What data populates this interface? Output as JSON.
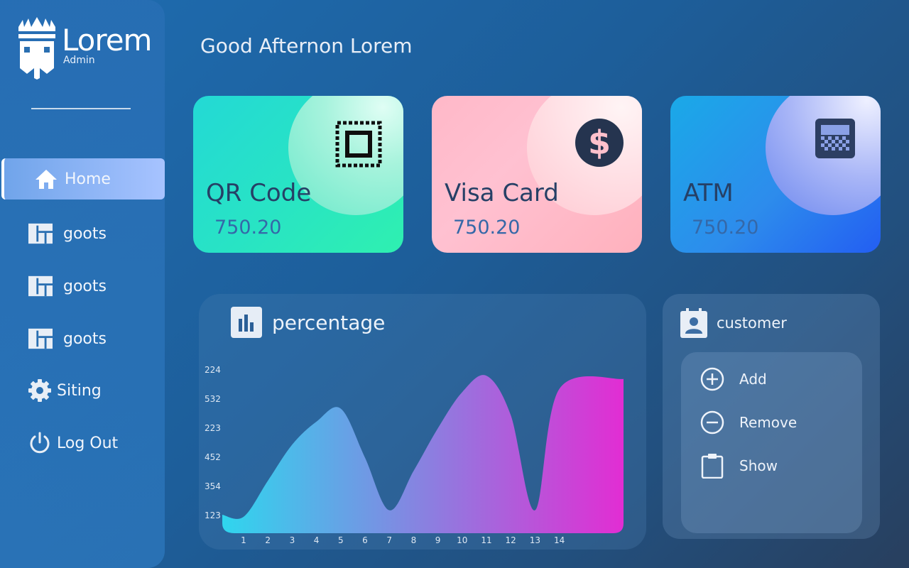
{
  "brand": {
    "title": "Lorem",
    "subtitle": "Admin"
  },
  "sidebar": {
    "items": [
      {
        "label": "Home",
        "icon": "home-icon",
        "active": true
      },
      {
        "label": "goots",
        "icon": "layout-icon"
      },
      {
        "label": "goots",
        "icon": "layout-icon"
      },
      {
        "label": "goots",
        "icon": "layout-icon"
      },
      {
        "label": "Siting",
        "icon": "gear-icon"
      },
      {
        "label": "Log Out",
        "icon": "power-icon"
      }
    ]
  },
  "greeting": "Good Afternon Lorem",
  "cards": [
    {
      "title": "QR Code",
      "value": "750.20",
      "icon": "qr-icon"
    },
    {
      "title": "Visa Card",
      "value": "750.20",
      "icon": "dollar-icon"
    },
    {
      "title": "ATM",
      "value": "750.20",
      "icon": "atm-icon"
    }
  ],
  "chart_panel": {
    "title": "percentage",
    "icon": "bar-chart-icon"
  },
  "chart_data": {
    "type": "area",
    "x": [
      1,
      2,
      3,
      4,
      5,
      6,
      7,
      8,
      9,
      10,
      11,
      12,
      13,
      14
    ],
    "y_tick_labels": [
      "224",
      "532",
      "223",
      "452",
      "354",
      "123"
    ],
    "values": [
      0.5,
      1.6,
      2.7,
      3.4,
      3.8,
      2.3,
      0.7,
      1.9,
      3.2,
      4.3,
      4.8,
      3.6,
      0.7,
      4.4
    ],
    "colors": [
      "#2fd6ee",
      "#e22dd3"
    ],
    "xlabel": "",
    "ylabel": ""
  },
  "customer_panel": {
    "title": "customer",
    "icon": "contact-card-icon",
    "actions": [
      {
        "label": "Add",
        "icon": "plus-circle-icon"
      },
      {
        "label": "Remove",
        "icon": "minus-circle-icon"
      },
      {
        "label": "Show",
        "icon": "clipboard-icon"
      }
    ]
  },
  "colors": {
    "accent": "#a7c3ff",
    "text_dark": "#264066",
    "value_blue": "#3568a8"
  }
}
